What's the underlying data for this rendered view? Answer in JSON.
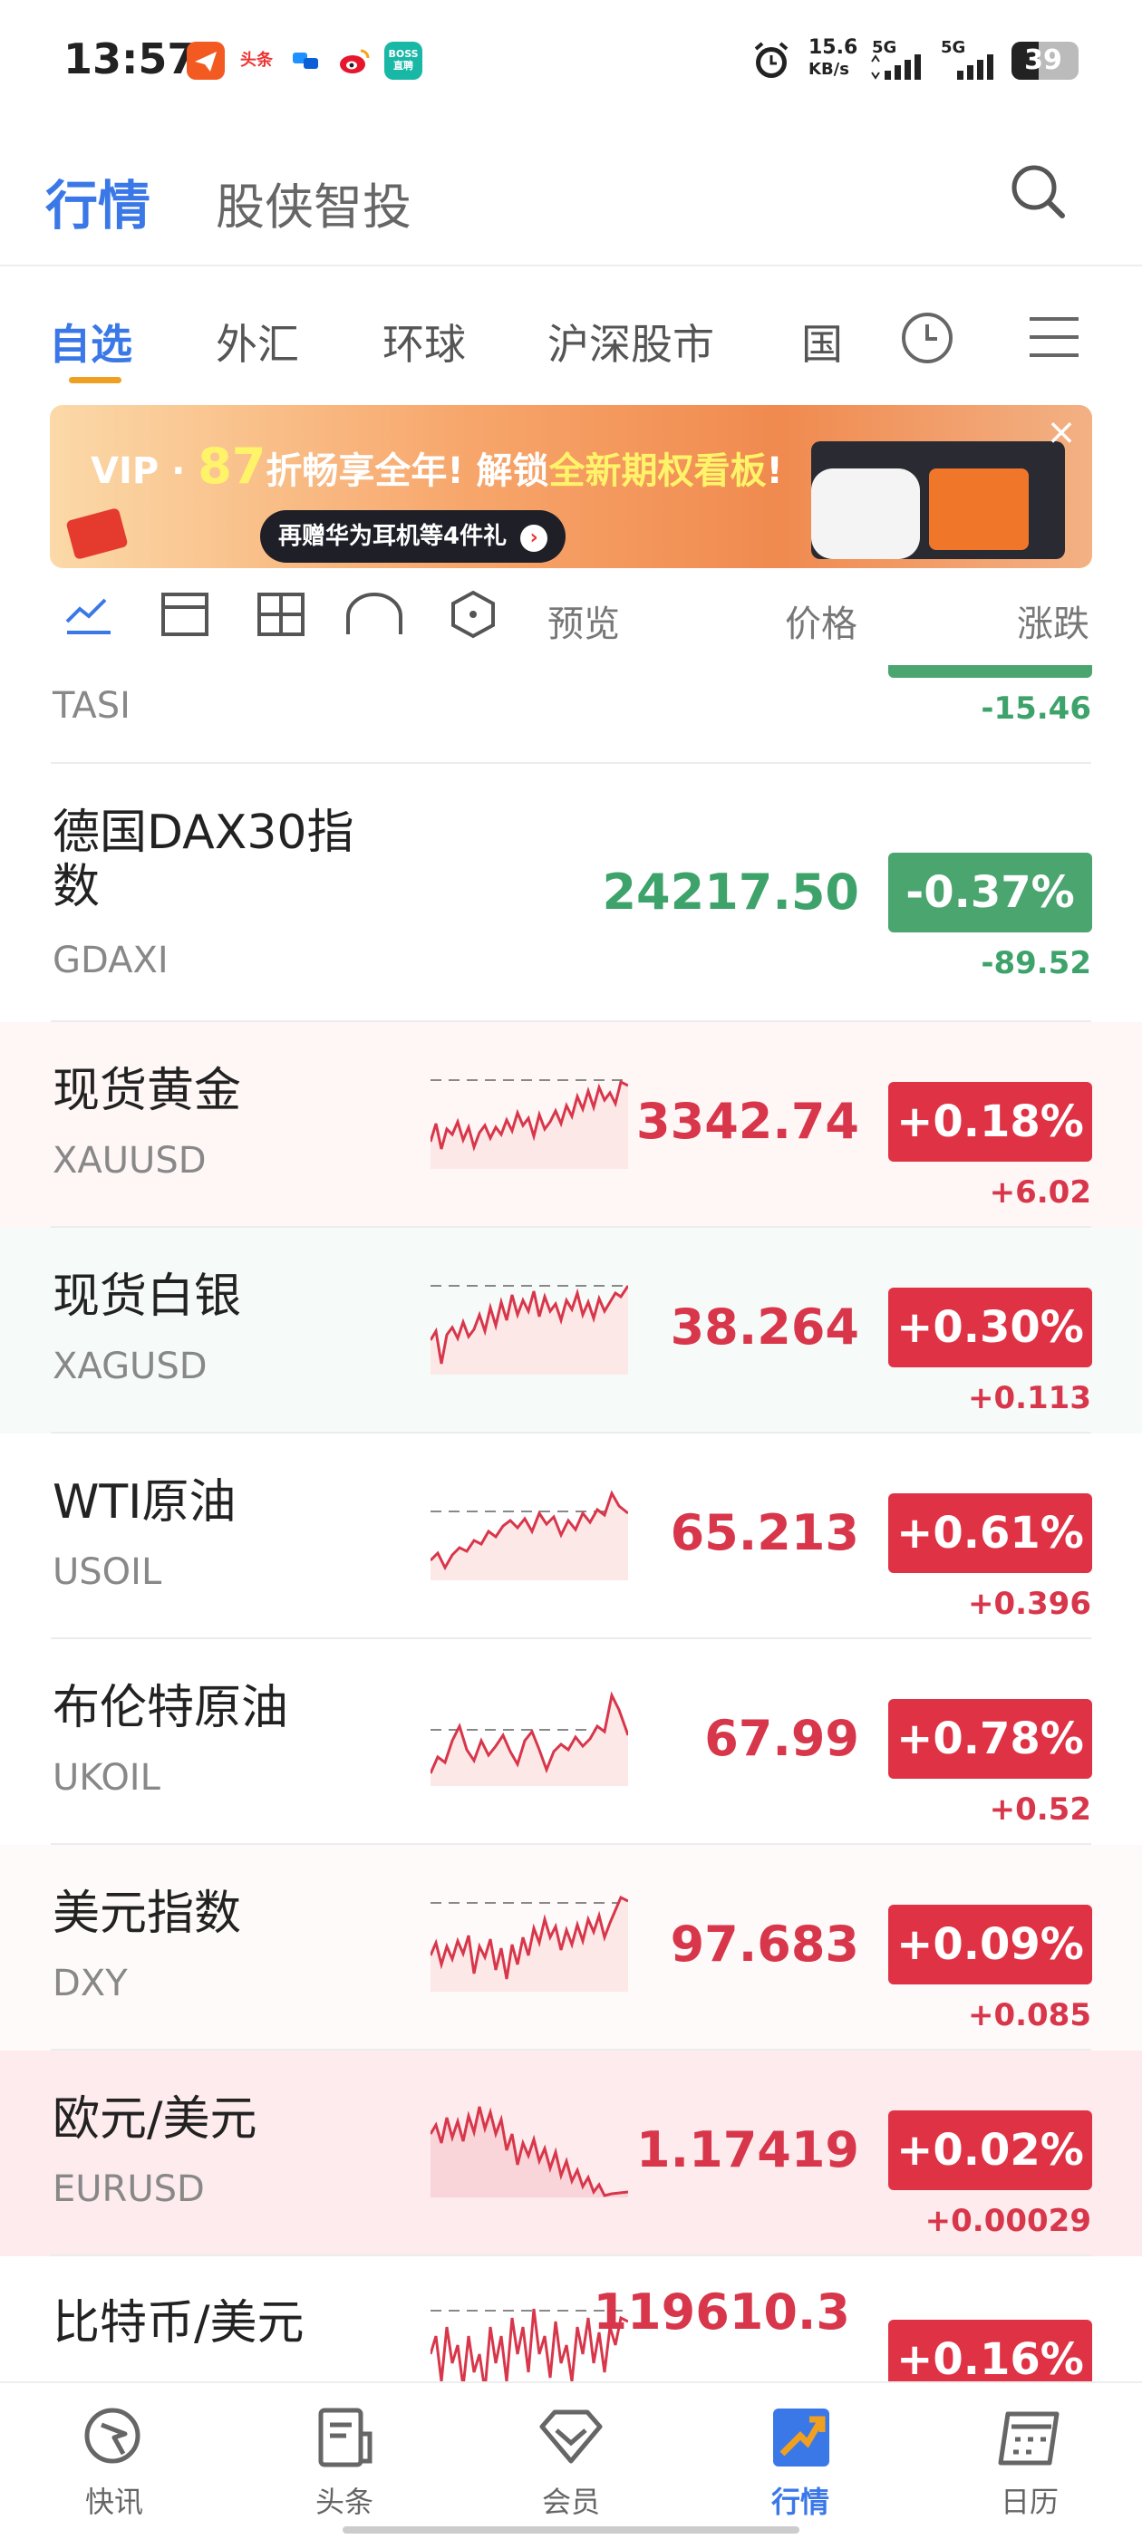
{
  "status_bar": {
    "time": "13:57",
    "net_speed_value": "15.6",
    "net_speed_unit": "KB/s",
    "signal1": "5G",
    "signal2": "5G",
    "battery": "39",
    "app_icons": [
      "paper-plane-app-icon",
      "toutiao-app-icon",
      "chat-app-icon",
      "weibo-app-icon",
      "boss-app-icon"
    ],
    "boss_label": "BOSS直聘",
    "toutiao_label": "头条"
  },
  "header": {
    "tab_active": "行情",
    "tab_other": "股侠智投"
  },
  "tabs": [
    "自选",
    "外汇",
    "环球",
    "沪深股市",
    "国"
  ],
  "banner": {
    "prefix": "VIP · ",
    "discount": "87",
    "mid": "折畅享全年! 解锁",
    "highlight": "全新期权看板",
    "suffix": "!",
    "sub": "再赠华为耳机等4件礼"
  },
  "toolbar": {
    "preview_label": "预览",
    "price_label": "价格",
    "change_label": "涨跌"
  },
  "partial_row": {
    "code": "TASI",
    "change": "-15.46"
  },
  "rows": [
    {
      "name": "德国DAX30指数",
      "code": "GDAXI",
      "price": "24217.50",
      "pct": "-0.37%",
      "change": "-89.52",
      "direction": "down",
      "spark": null
    },
    {
      "name": "现货黄金",
      "code": "XAUUSD",
      "price": "3342.74",
      "pct": "+0.18%",
      "change": "+6.02",
      "direction": "up"
    },
    {
      "name": "现货白银",
      "code": "XAGUSD",
      "price": "38.264",
      "pct": "+0.30%",
      "change": "+0.113",
      "direction": "up"
    },
    {
      "name": "WTI原油",
      "code": "USOIL",
      "price": "65.213",
      "pct": "+0.61%",
      "change": "+0.396",
      "direction": "up"
    },
    {
      "name": "布伦特原油",
      "code": "UKOIL",
      "price": "67.99",
      "pct": "+0.78%",
      "change": "+0.52",
      "direction": "up"
    },
    {
      "name": "美元指数",
      "code": "DXY",
      "price": "97.683",
      "pct": "+0.09%",
      "change": "+0.085",
      "direction": "up"
    },
    {
      "name": "欧元/美元",
      "code": "EURUSD",
      "price": "1.17419",
      "pct": "+0.02%",
      "change": "+0.00029",
      "direction": "up"
    },
    {
      "name": "比特币/美元",
      "code": "",
      "price": "119610.3",
      "pct": "+0.16%",
      "change": "",
      "direction": "up"
    }
  ],
  "bottom_nav": [
    {
      "label": "快讯",
      "icon": "flash-news-icon"
    },
    {
      "label": "头条",
      "icon": "headlines-icon"
    },
    {
      "label": "会员",
      "icon": "member-icon"
    },
    {
      "label": "行情",
      "icon": "market-icon"
    },
    {
      "label": "日历",
      "icon": "calendar-icon"
    }
  ],
  "colors": {
    "accent": "#3b78e7",
    "up": "#e03245",
    "down": "#4aa56f",
    "tab_underline": "#f0a020"
  }
}
